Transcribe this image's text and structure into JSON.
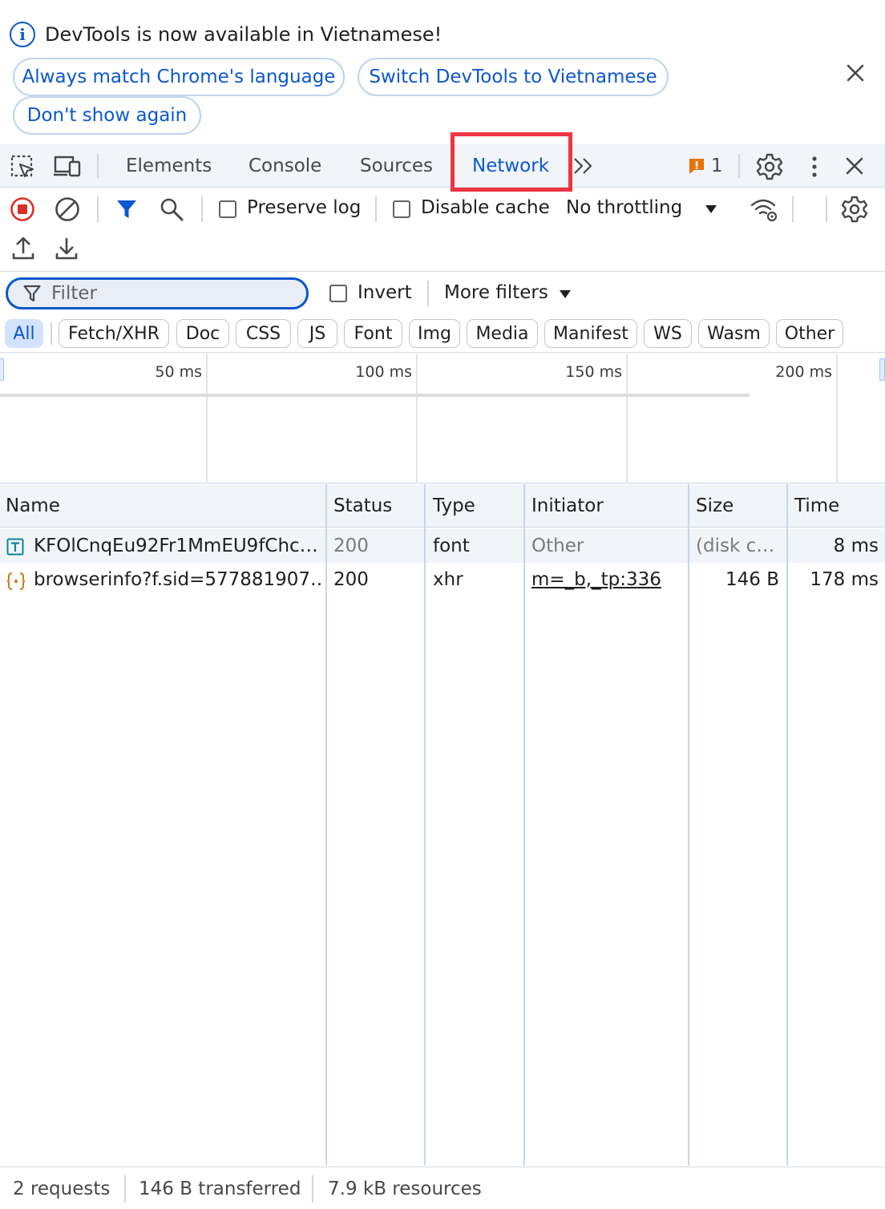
{
  "infobar": {
    "message": "DevTools is now available in Vietnamese!",
    "info_icon_glyph": "i",
    "buttons": {
      "match_language": "Always match Chrome's language",
      "switch_language": "Switch DevTools to Vietnamese",
      "dont_show": "Don't show again"
    }
  },
  "tabs": {
    "elements": "Elements",
    "console": "Console",
    "sources": "Sources",
    "network": "Network",
    "active": "network"
  },
  "issues": {
    "count": "1"
  },
  "toolbar": {
    "preserve_log": "Preserve log",
    "disable_cache": "Disable cache",
    "throttling": "No throttling",
    "preserve_log_checked": false,
    "disable_cache_checked": false
  },
  "filter": {
    "placeholder": "Filter",
    "invert": "Invert",
    "more_filters": "More filters"
  },
  "type_chips": {
    "all": "All",
    "fetch_xhr": "Fetch/XHR",
    "doc": "Doc",
    "css": "CSS",
    "js": "JS",
    "font": "Font",
    "img": "Img",
    "media": "Media",
    "manifest": "Manifest",
    "ws": "WS",
    "wasm": "Wasm",
    "other": "Other",
    "active": "all"
  },
  "timeline": {
    "ticks": [
      "50 ms",
      "100 ms",
      "150 ms",
      "200 ms"
    ]
  },
  "table": {
    "columns": {
      "name": "Name",
      "status": "Status",
      "type": "Type",
      "initiator": "Initiator",
      "size": "Size",
      "time": "Time"
    },
    "rows": [
      {
        "name": "KFOlCnqEu92Fr1MmEU9fChc…",
        "status": "200",
        "type": "font",
        "initiator": "Other",
        "size": "(disk c…",
        "time": "8 ms",
        "icon": "font-file-icon"
      },
      {
        "name": "browserinfo?f.sid=577881907…",
        "status": "200",
        "type": "xhr",
        "initiator": "m=_b,_tp:336",
        "size": "146 B",
        "time": "178 ms",
        "icon": "xhr-braces-icon"
      }
    ]
  },
  "statusbar": {
    "requests": "2 requests",
    "transferred": "146 B transferred",
    "resources": "7.9 kB resources"
  },
  "colors": {
    "accent": "#0b57d0",
    "highlight_box": "#ee3543",
    "issue_badge": "#e8710a",
    "record_red": "#d93025"
  }
}
